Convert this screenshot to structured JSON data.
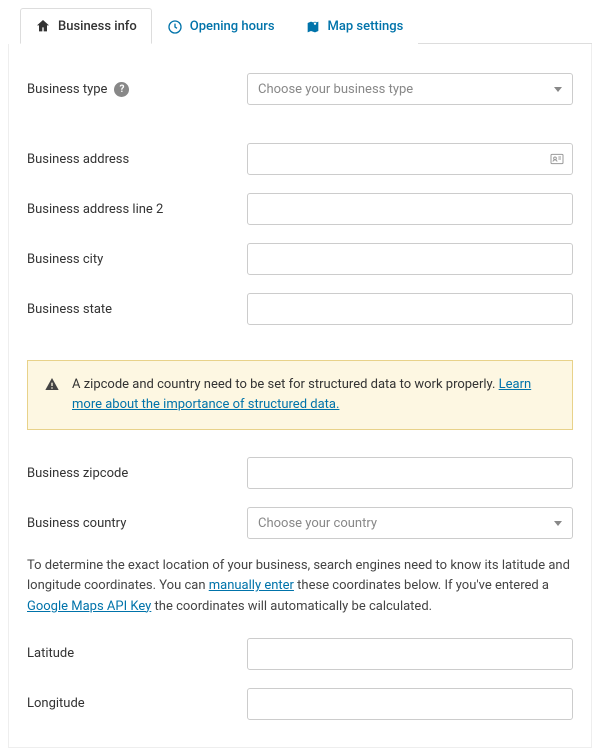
{
  "tabs": {
    "business_info": "Business info",
    "opening_hours": "Opening hours",
    "map_settings": "Map settings"
  },
  "labels": {
    "business_type": "Business type",
    "business_address": "Business address",
    "business_address_2": "Business address line 2",
    "business_city": "Business city",
    "business_state": "Business state",
    "business_zipcode": "Business zipcode",
    "business_country": "Business country",
    "latitude": "Latitude",
    "longitude": "Longitude"
  },
  "placeholders": {
    "business_type": "Choose your business type",
    "business_country": "Choose your country"
  },
  "help_tip": "?",
  "notice": {
    "text_before": "A zipcode and country need to be set for structured data to work properly. ",
    "link_text": "Learn more about the importance of structured data."
  },
  "paragraph": {
    "p1": "To determine the exact location of your business, search engines need to know its latitude and longitude coordinates. You can ",
    "link1": "manually enter",
    "p2": " these coordinates below. If you've entered a ",
    "link2": "Google Maps API Key",
    "p3": " the coordinates will automatically be calculated."
  }
}
